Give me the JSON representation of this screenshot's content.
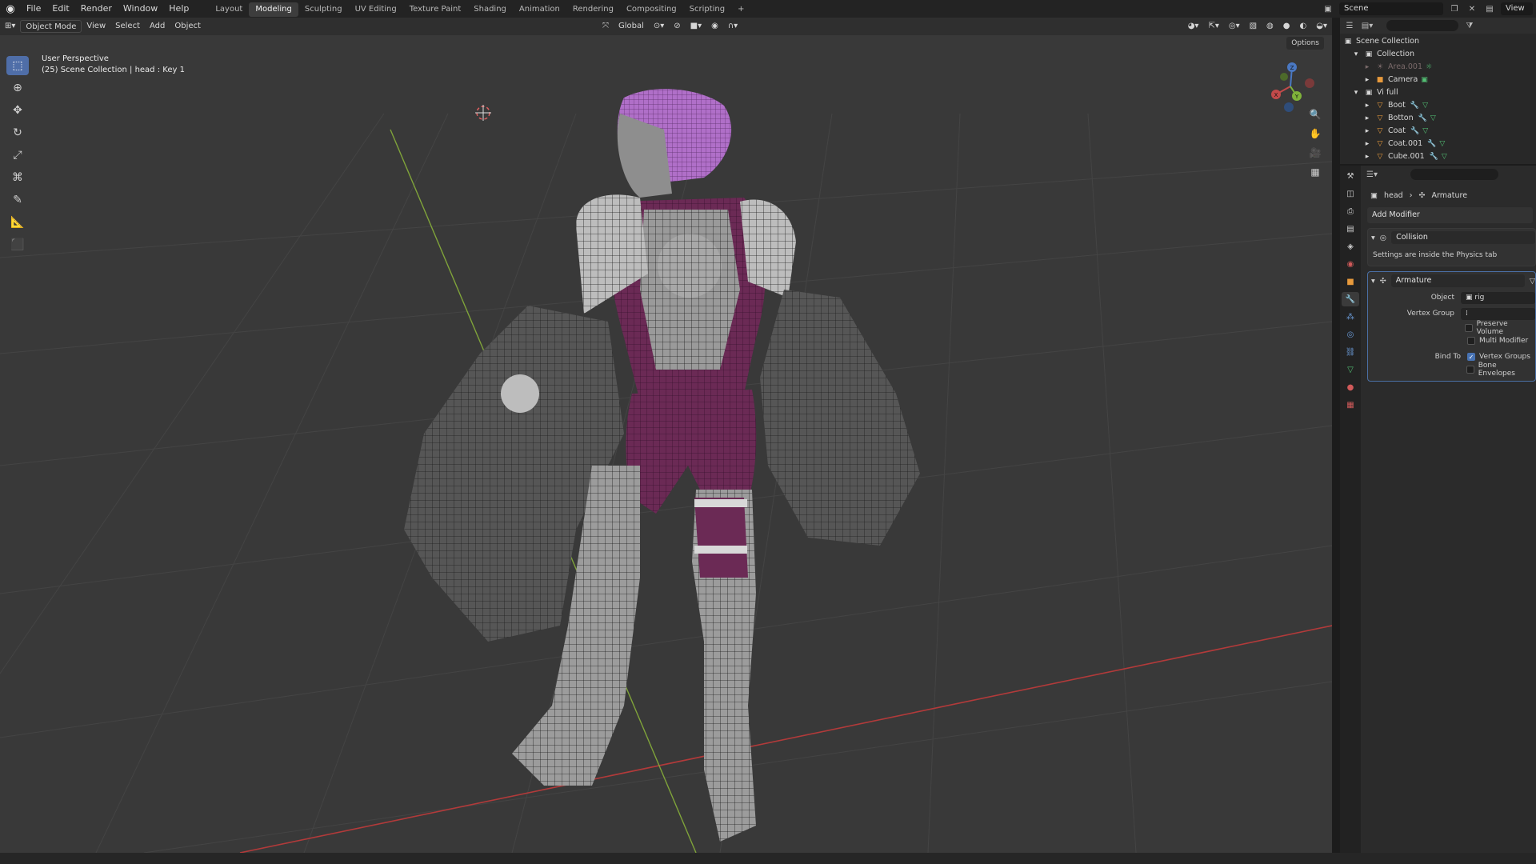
{
  "menu": {
    "items": [
      "File",
      "Edit",
      "Render",
      "Window",
      "Help"
    ]
  },
  "workspaces": {
    "tabs": [
      "Layout",
      "Modeling",
      "Sculpting",
      "UV Editing",
      "Texture Paint",
      "Shading",
      "Animation",
      "Rendering",
      "Compositing",
      "Scripting",
      "+"
    ],
    "active_index": 1
  },
  "topbar_right": {
    "scene_name": "Scene",
    "view_layer": "View La"
  },
  "viewport": {
    "mode": "Object Mode",
    "menus": [
      "View",
      "Select",
      "Add",
      "Object"
    ],
    "transform_orientation": "Global",
    "options_label": "Options",
    "overlay_title": "User Perspective",
    "overlay_subtitle": "(25) Scene Collection | head : Key 1",
    "gizmo_axes": [
      "X",
      "Y",
      "Z"
    ]
  },
  "outliner": {
    "root": "Scene Collection",
    "items": [
      {
        "label": "Collection",
        "type": "collection",
        "depth": 1
      },
      {
        "label": "Area.001",
        "type": "light",
        "depth": 2,
        "dim": true
      },
      {
        "label": "Camera",
        "type": "camera",
        "depth": 2
      },
      {
        "label": "Vi full",
        "type": "collection",
        "depth": 1
      },
      {
        "label": "Boot",
        "type": "mesh",
        "depth": 2
      },
      {
        "label": "Botton",
        "type": "mesh",
        "depth": 2
      },
      {
        "label": "Coat",
        "type": "mesh",
        "depth": 2
      },
      {
        "label": "Coat.001",
        "type": "mesh",
        "depth": 2
      },
      {
        "label": "Cube.001",
        "type": "mesh",
        "depth": 2
      }
    ]
  },
  "properties": {
    "breadcrumb": {
      "object": "head",
      "modifier": "Armature"
    },
    "add_modifier_label": "Add Modifier",
    "collision": {
      "name": "Collision",
      "note": "Settings are inside the Physics tab"
    },
    "armature": {
      "name": "Armature",
      "object_label": "Object",
      "object_value": "rig",
      "vertex_group_label": "Vertex Group",
      "vertex_group_value": "",
      "preserve_volume_label": "Preserve Volume",
      "preserve_volume": false,
      "multi_modifier_label": "Multi Modifier",
      "multi_modifier": false,
      "bind_to_label": "Bind To",
      "vertex_groups_label": "Vertex Groups",
      "vertex_groups": true,
      "bone_envelopes_label": "Bone Envelopes",
      "bone_envelopes": false
    }
  },
  "colors": {
    "accent": "#4772b3",
    "grid_red": "#b23a3a",
    "grid_green": "#7fa33a",
    "hair": "#b06fc8",
    "suit": "#6b2a55"
  }
}
